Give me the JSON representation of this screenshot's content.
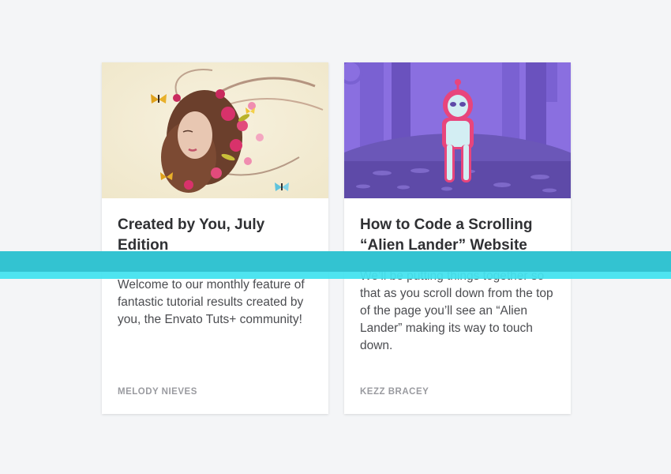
{
  "colors": {
    "background": "#f4f5f7",
    "card": "#ffffff",
    "title_text": "#2f3033",
    "body_text": "#4b4c50",
    "author_text": "#9a9ba0",
    "accent_band": "#33c3d1"
  },
  "cards": [
    {
      "title": "Created by You, July Edition",
      "description": "Welcome to our monthly feature of fantastic tutorial results created by you, the Envato Tuts+ community!",
      "author": "MELODY NIEVES",
      "image": "woman-with-flowers-and-butterflies-illustration"
    },
    {
      "title": "How to Code a Scrolling “Alien Lander” Website",
      "description": "We’ll be putting things together so that as you scroll down from the top of the page you’ll see an “Alien Lander” making its way to touch down.",
      "author": "KEZZ BRACEY",
      "image": "alien-in-purple-forest-illustration"
    }
  ]
}
